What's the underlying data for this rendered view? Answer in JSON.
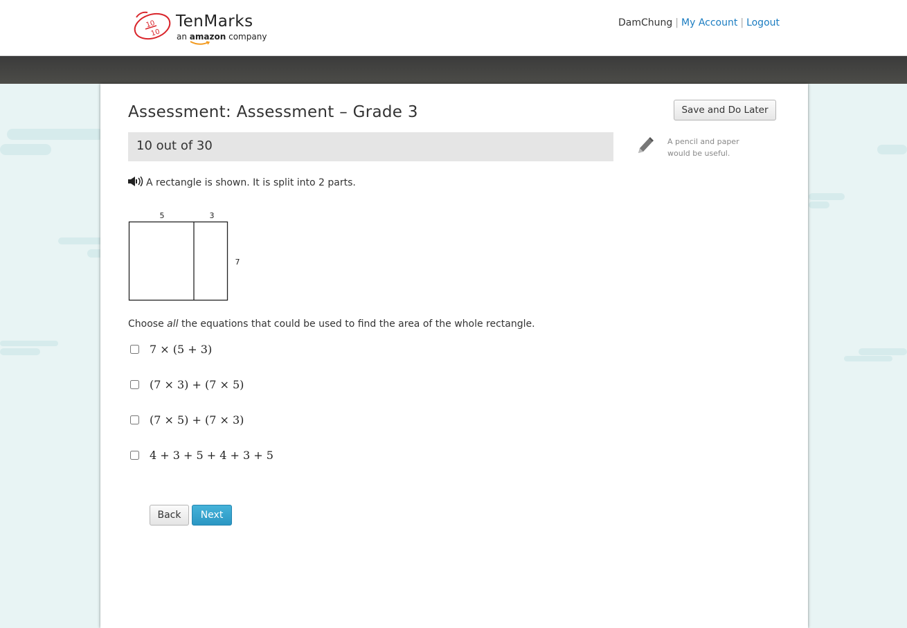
{
  "header": {
    "brand_name": "TenMarks",
    "brand_tagline_pre": "an",
    "brand_tagline_amazon": "amazon",
    "brand_tagline_post": "company",
    "username": "DamChung",
    "my_account_label": "My Account",
    "logout_label": "Logout"
  },
  "assessment": {
    "title": "Assessment: Assessment – Grade 3",
    "save_later_label": "Save and Do Later",
    "progress_text": "10 out of 30",
    "tip_text": "A pencil and paper would be useful."
  },
  "question": {
    "text": "A rectangle is shown. It is split into 2 parts.",
    "diagram": {
      "top_left_label": "5",
      "top_right_label": "3",
      "side_label": "7"
    },
    "prompt_pre": "Choose",
    "prompt_emph": "all",
    "prompt_post": "the equations that could be used to find the area of the whole rectangle.",
    "choices": [
      {
        "expr": "7 × (5 + 3)",
        "checked": false
      },
      {
        "expr": "(7 × 3) + (7 × 5)",
        "checked": false
      },
      {
        "expr": "(7 × 5) + (7 × 3)",
        "checked": false
      },
      {
        "expr": "4 + 3 + 5 + 4 + 3 + 5",
        "checked": false
      }
    ]
  },
  "nav": {
    "back_label": "Back",
    "next_label": "Next"
  },
  "colors": {
    "link": "#1a7cc1",
    "next_button": "#2b97c3",
    "background": "#e8f4f4",
    "dark_bar": "#444441"
  }
}
